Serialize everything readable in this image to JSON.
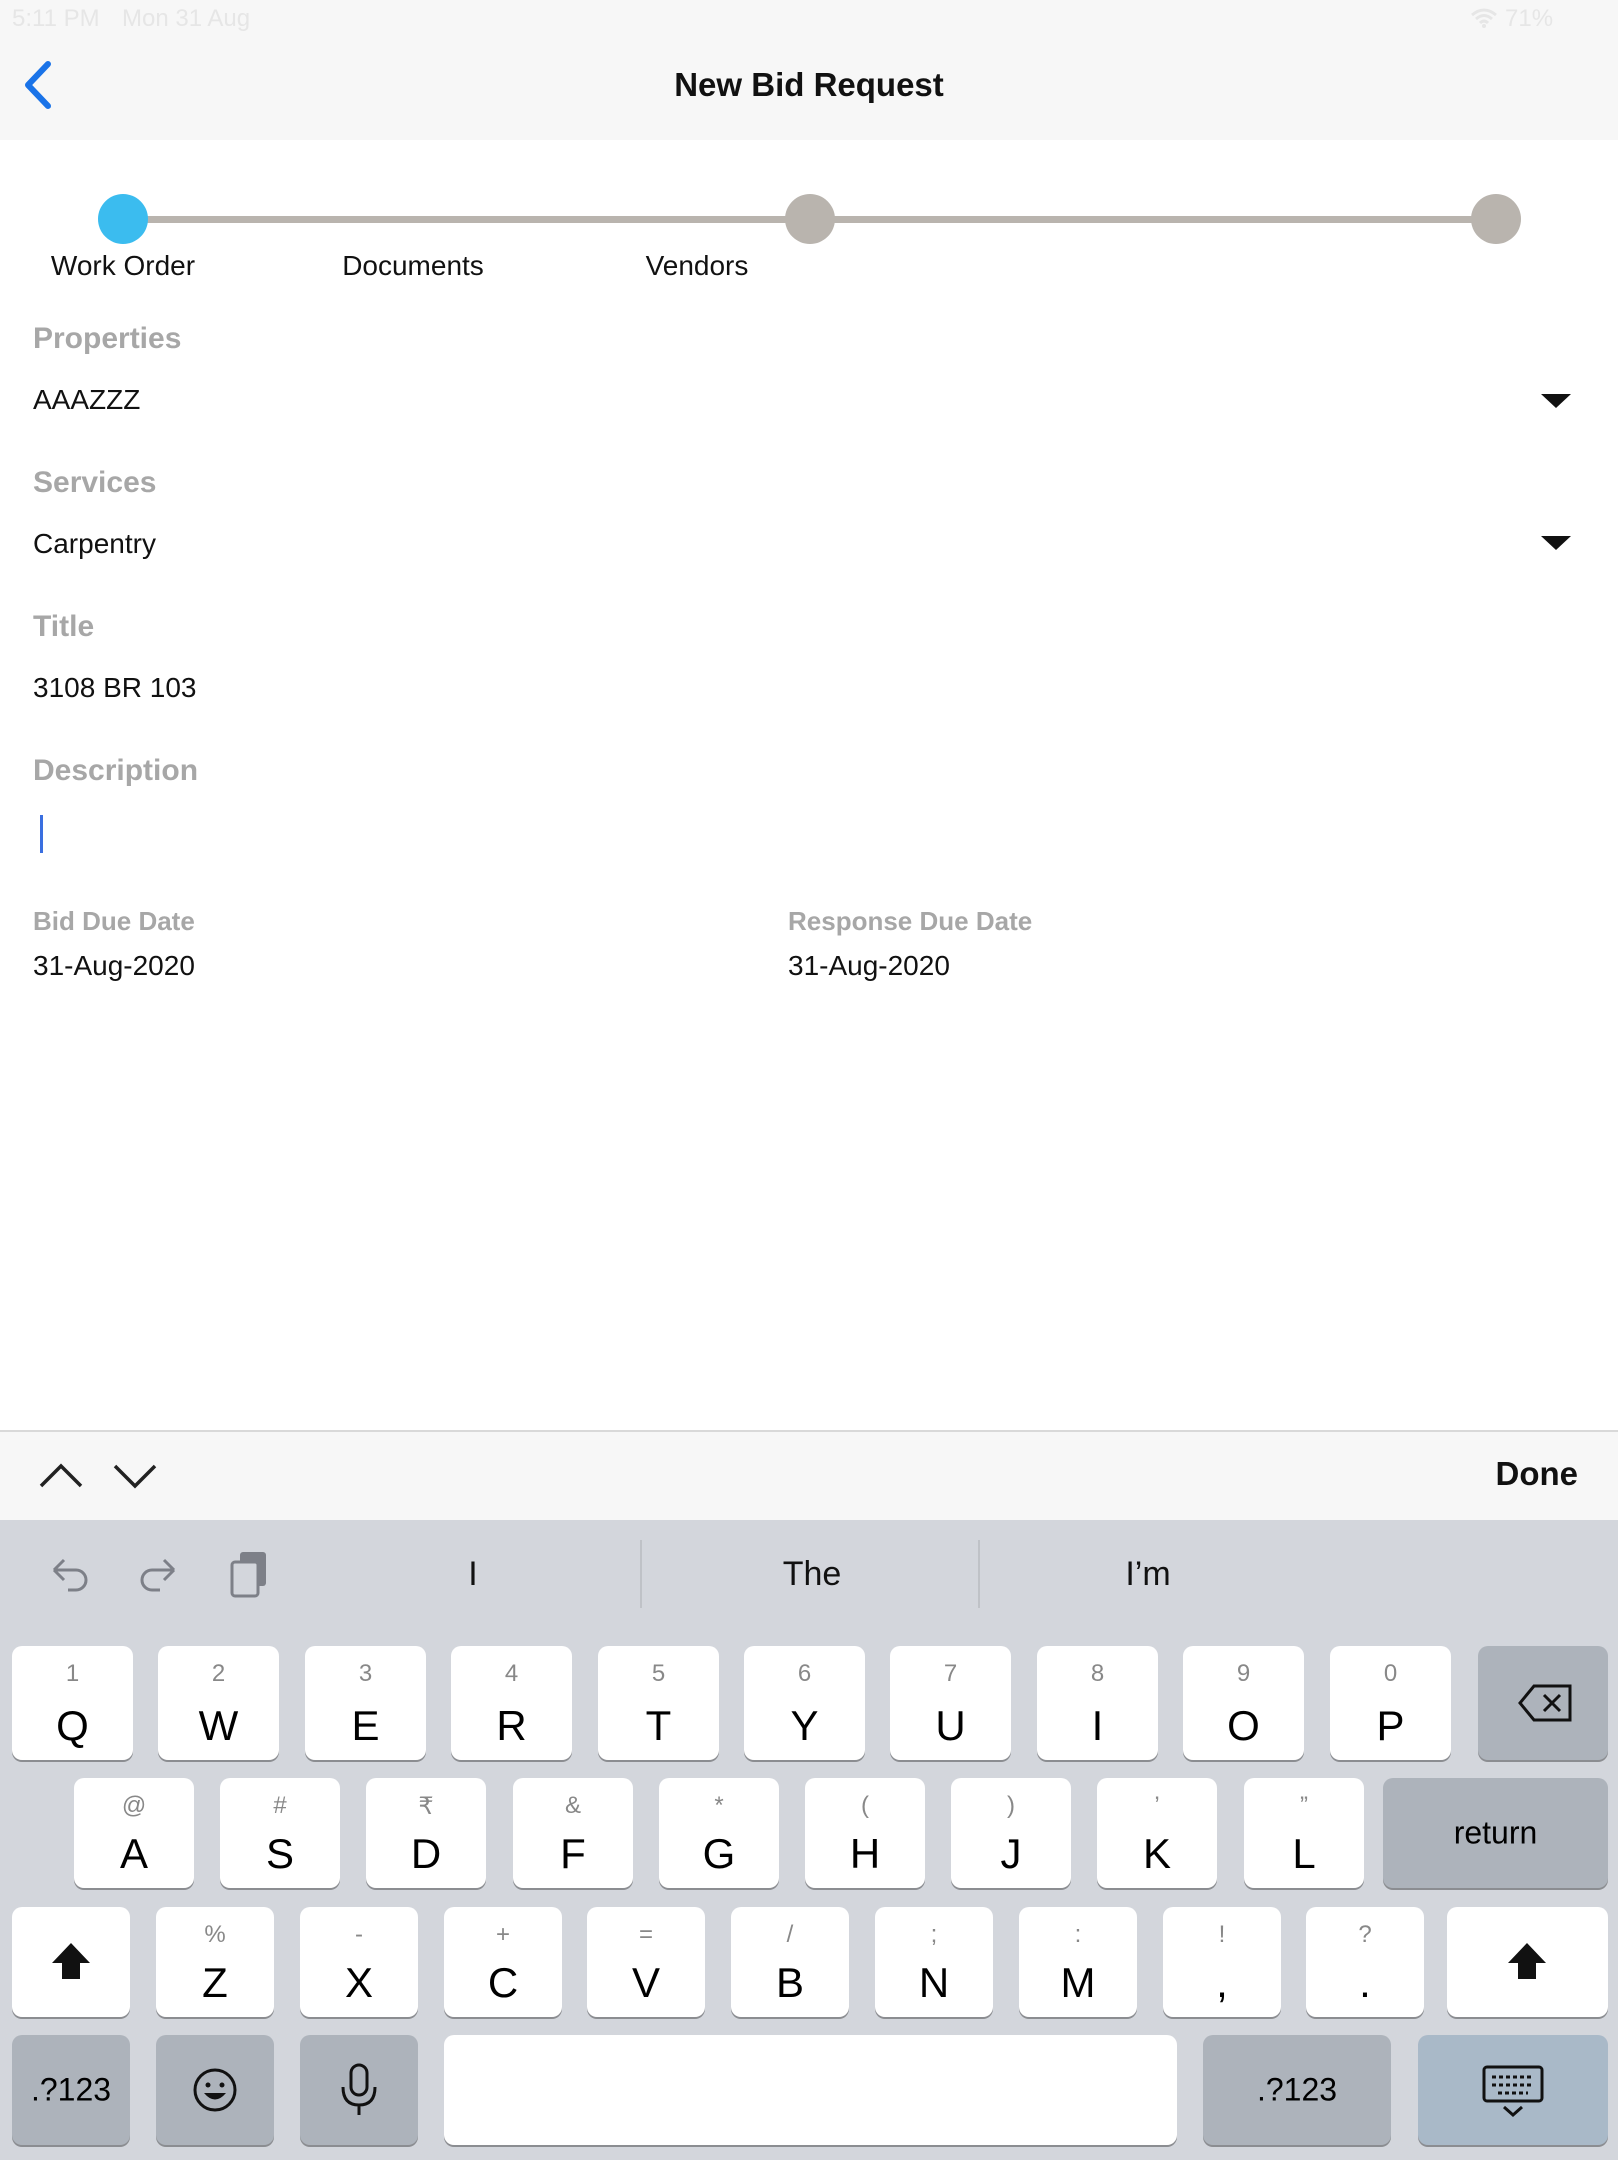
{
  "status_bar": {
    "time": "5:11 PM",
    "date": "Mon 31 Aug",
    "battery": "71%"
  },
  "nav": {
    "title": "New Bid Request",
    "back_icon": "chevron-left-icon"
  },
  "stepper": {
    "steps": [
      "Work Order",
      "Documents",
      "Vendors"
    ],
    "active_step": 0
  },
  "form": {
    "properties": {
      "label": "Properties",
      "value": "AAAZZZ"
    },
    "services": {
      "label": "Services",
      "value": "Carpentry"
    },
    "title": {
      "label": "Title",
      "value": "3108 BR 103"
    },
    "description": {
      "label": "Description",
      "value": ""
    },
    "bid_due_date": {
      "label": "Bid Due Date",
      "value": "31-Aug-2020"
    },
    "response_due_date": {
      "label": "Response Due Date",
      "value": "31-Aug-2020"
    }
  },
  "accessory": {
    "done_label": "Done"
  },
  "keyboard": {
    "suggestions": [
      "I",
      "The",
      "I’m"
    ],
    "row1": [
      {
        "hint": "1",
        "key": "Q"
      },
      {
        "hint": "2",
        "key": "W"
      },
      {
        "hint": "3",
        "key": "E"
      },
      {
        "hint": "4",
        "key": "R"
      },
      {
        "hint": "5",
        "key": "T"
      },
      {
        "hint": "6",
        "key": "Y"
      },
      {
        "hint": "7",
        "key": "U"
      },
      {
        "hint": "8",
        "key": "I"
      },
      {
        "hint": "9",
        "key": "O"
      },
      {
        "hint": "0",
        "key": "P"
      }
    ],
    "row2": [
      {
        "hint": "@",
        "key": "A"
      },
      {
        "hint": "#",
        "key": "S"
      },
      {
        "hint": "₹",
        "key": "D"
      },
      {
        "hint": "&",
        "key": "F"
      },
      {
        "hint": "*",
        "key": "G"
      },
      {
        "hint": "(",
        "key": "H"
      },
      {
        "hint": ")",
        "key": "J"
      },
      {
        "hint": "’",
        "key": "K"
      },
      {
        "hint": "”",
        "key": "L"
      }
    ],
    "row3": [
      {
        "hint": "%",
        "key": "Z"
      },
      {
        "hint": "-",
        "key": "X"
      },
      {
        "hint": "+",
        "key": "C"
      },
      {
        "hint": "=",
        "key": "V"
      },
      {
        "hint": "/",
        "key": "B"
      },
      {
        "hint": ";",
        "key": "N"
      },
      {
        "hint": ":",
        "key": "M"
      },
      {
        "hint": "!",
        "key": ","
      },
      {
        "hint": "?",
        "key": "."
      }
    ],
    "return_label": "return",
    "numbers_label": ".?123"
  }
}
